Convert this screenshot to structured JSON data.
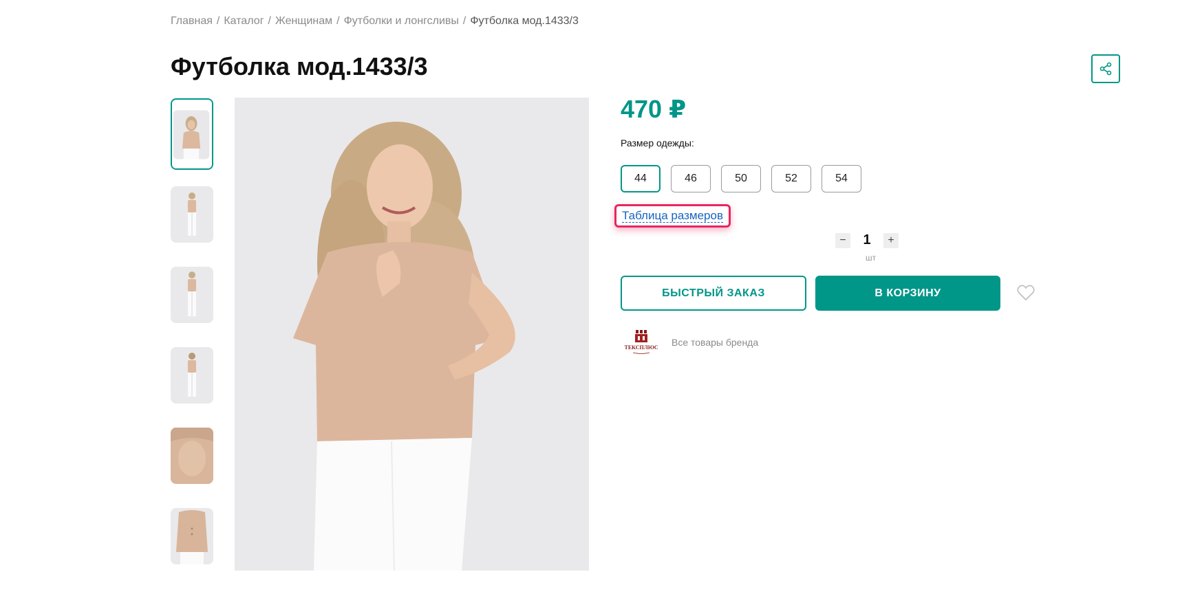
{
  "breadcrumb": {
    "items": [
      {
        "label": "Главная"
      },
      {
        "label": "Каталог"
      },
      {
        "label": "Женщинам"
      },
      {
        "label": "Футболки и лонгсливы"
      }
    ],
    "separator": "/",
    "current": "Футболка мод.1433/3"
  },
  "product": {
    "title": "Футболка мод.1433/3",
    "price": "470 ₽",
    "size_label": "Размер одежды:",
    "sizes": [
      "44",
      "46",
      "50",
      "52",
      "54"
    ],
    "selected_size": "44",
    "size_table_link": "Таблица размеров",
    "quantity": "1",
    "quantity_unit": "шт",
    "quick_order_label": "БЫСТРЫЙ ЗАКАЗ",
    "to_cart_label": "В КОРЗИНУ",
    "brand_link": "Все товары бренда",
    "brand_logo_text": "ТЕКСПЛЮС"
  },
  "icons": {
    "share": "share-icon",
    "favorite": "heart-icon",
    "minus": "minus-icon",
    "plus": "plus-icon"
  },
  "colors": {
    "accent": "#009688",
    "highlight": "#e8265e",
    "link": "#1565c0"
  }
}
